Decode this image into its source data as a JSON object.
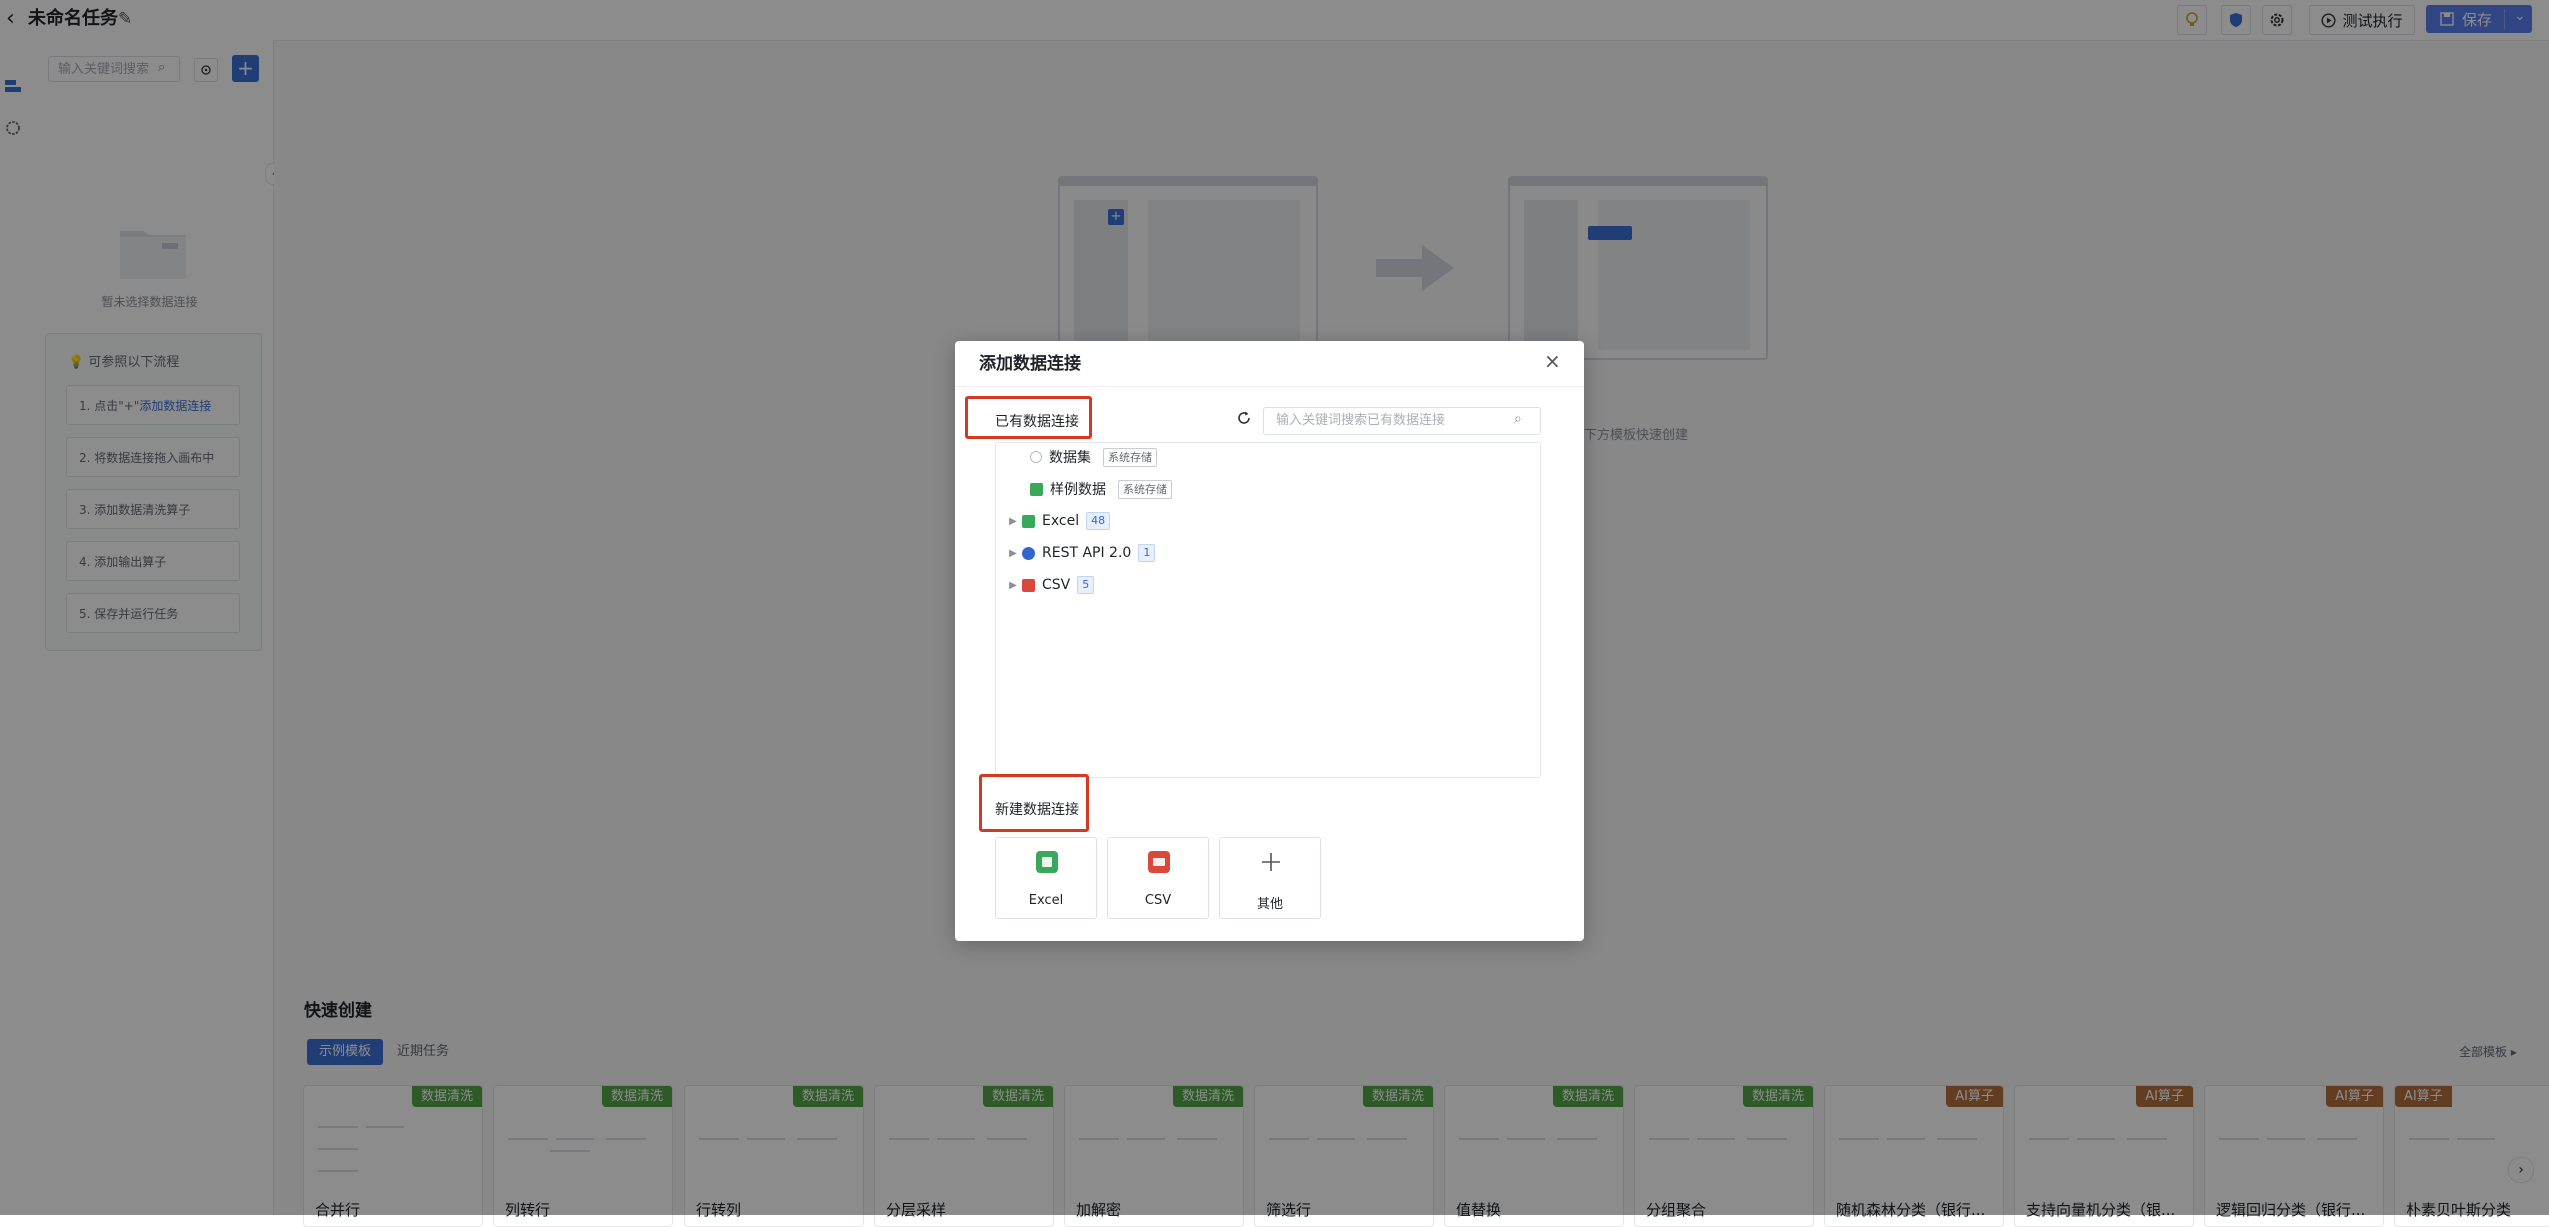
{
  "header": {
    "back": "‹",
    "title": "未命名任务",
    "run_label": "测试执行",
    "save_label": "保存"
  },
  "side": {
    "search_placeholder": "输入关键词搜索",
    "empty_text": "暂未选择数据连接",
    "steps_title": "可参照以下流程",
    "step1_prefix": "1. 点击\"+\"",
    "step1_link": "添加数据连接",
    "steps": [
      "2. 将数据连接拖入画布中",
      "3. 添加数据清洗算子",
      "4. 添加输出算子",
      "5. 保存并运行任务"
    ]
  },
  "canvas": {
    "hint_suffix": "下方模板快速创建",
    "quick_title": "快速创建",
    "tab_examples": "示例模板",
    "tab_recent": "近期任务",
    "all_templates": "全部模板",
    "templates": [
      {
        "name": "合并行",
        "tag": "数据清洗"
      },
      {
        "name": "列转行",
        "tag": "数据清洗"
      },
      {
        "name": "行转列",
        "tag": "数据清洗"
      },
      {
        "name": "分层采样",
        "tag": "数据清洗"
      },
      {
        "name": "加解密",
        "tag": "数据清洗"
      },
      {
        "name": "筛选行",
        "tag": "数据清洗"
      },
      {
        "name": "值替换",
        "tag": "数据清洗"
      },
      {
        "name": "分组聚合",
        "tag": "数据清洗"
      },
      {
        "name": "随机森林分类（银行...",
        "tag": "AI算子"
      },
      {
        "name": "支持向量机分类（银...",
        "tag": "AI算子"
      },
      {
        "name": "逻辑回归分类（银行...",
        "tag": "AI算子"
      },
      {
        "name": "朴素贝叶斯分类",
        "tag": "AI算子"
      }
    ],
    "colors": {
      "tag_clean": "#52a447",
      "tag_ai": "#b5703f",
      "accent": "#5a7ef0"
    }
  },
  "modal": {
    "title": "添加数据连接",
    "close": "×",
    "existing_label": "已有数据连接",
    "search_placeholder": "输入关键词搜索已有数据连接",
    "tree": [
      {
        "label": "数据集",
        "tag": "系统存储",
        "icon": "dataset-icon"
      },
      {
        "label": "样例数据",
        "tag": "系统存储",
        "icon": "sample-data-icon"
      },
      {
        "label": "Excel",
        "count": "48",
        "icon": "excel-icon"
      },
      {
        "label": "REST API 2.0",
        "count": "1",
        "icon": "rest-api-icon"
      },
      {
        "label": "CSV",
        "count": "5",
        "icon": "csv-icon"
      }
    ],
    "new_label": "新建数据连接",
    "new_options": [
      {
        "label": "Excel",
        "icon": "excel-icon"
      },
      {
        "label": "CSV",
        "icon": "csv-icon"
      },
      {
        "label": "其他",
        "icon": "plus-icon"
      }
    ],
    "highlight_color": "#d23a22"
  }
}
